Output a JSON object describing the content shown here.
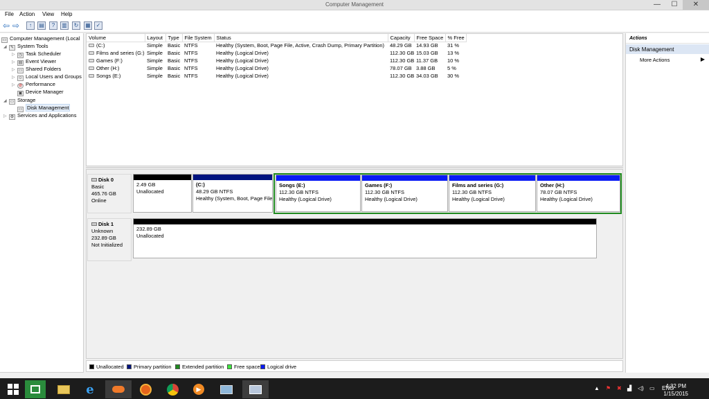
{
  "window": {
    "title": "Computer Management",
    "minimize": "—",
    "maximize": "☐",
    "close": "✕"
  },
  "menu": [
    "File",
    "Action",
    "View",
    "Help"
  ],
  "tree": [
    {
      "label": "Computer Management (Local",
      "indent": 0,
      "exp": ""
    },
    {
      "label": "System Tools",
      "indent": 1,
      "exp": "◢"
    },
    {
      "label": "Task Scheduler",
      "indent": 2,
      "exp": "▷"
    },
    {
      "label": "Event Viewer",
      "indent": 2,
      "exp": "▷"
    },
    {
      "label": "Shared Folders",
      "indent": 2,
      "exp": "▷"
    },
    {
      "label": "Local Users and Groups",
      "indent": 2,
      "exp": "▷"
    },
    {
      "label": "Performance",
      "indent": 2,
      "exp": "▷"
    },
    {
      "label": "Device Manager",
      "indent": 2,
      "exp": ""
    },
    {
      "label": "Storage",
      "indent": 1,
      "exp": "◢"
    },
    {
      "label": "Disk Management",
      "indent": 2,
      "exp": "",
      "selected": true
    },
    {
      "label": "Services and Applications",
      "indent": 1,
      "exp": "▷"
    }
  ],
  "volume_table": {
    "headers": [
      "Volume",
      "Layout",
      "Type",
      "File System",
      "Status",
      "Capacity",
      "Free Space",
      "% Free"
    ],
    "rows": [
      [
        "(C:)",
        "Simple",
        "Basic",
        "NTFS",
        "Healthy (System, Boot, Page File, Active, Crash Dump, Primary Partition)",
        "48.29 GB",
        "14.93 GB",
        "31 %"
      ],
      [
        "Films and series (G:)",
        "Simple",
        "Basic",
        "NTFS",
        "Healthy (Logical Drive)",
        "112.30 GB",
        "15.03 GB",
        "13 %"
      ],
      [
        "Games (F:)",
        "Simple",
        "Basic",
        "NTFS",
        "Healthy (Logical Drive)",
        "112.30 GB",
        "11.37 GB",
        "10 %"
      ],
      [
        "Other (H:)",
        "Simple",
        "Basic",
        "NTFS",
        "Healthy (Logical Drive)",
        "78.07 GB",
        "3.88 GB",
        "5 %"
      ],
      [
        "Songs (E:)",
        "Simple",
        "Basic",
        "NTFS",
        "Healthy (Logical Drive)",
        "112.30 GB",
        "34.03 GB",
        "30 %"
      ]
    ]
  },
  "disks": [
    {
      "name": "Disk 0",
      "kind": "Basic",
      "size": "465.76 GB",
      "state": "Online",
      "partitions": [
        {
          "title": "",
          "size": "2.49 GB",
          "status": "Unallocated",
          "color": "#000000"
        },
        {
          "title": "(C:)",
          "size": "48.29 GB NTFS",
          "status": "Healthy (System, Boot, Page File",
          "color": "#00137f"
        },
        {
          "title": "Songs  (E:)",
          "size": "112.30 GB NTFS",
          "status": "Healthy (Logical Drive)",
          "color": "#0a1cf5"
        },
        {
          "title": "Games  (F:)",
          "size": "112.30 GB NTFS",
          "status": "Healthy (Logical Drive)",
          "color": "#0a1cf5"
        },
        {
          "title": "Films and series  (G:)",
          "size": "112.30 GB NTFS",
          "status": "Healthy (Logical Drive)",
          "color": "#0a1cf5"
        },
        {
          "title": "Other  (H:)",
          "size": "78.07 GB NTFS",
          "status": "Healthy (Logical Drive)",
          "color": "#0a1cf5"
        }
      ]
    },
    {
      "name": "Disk 1",
      "kind": "Unknown",
      "size": "232.89 GB",
      "state": "Not Initialized",
      "partitions": [
        {
          "title": "",
          "size": "232.89 GB",
          "status": "Unallocated",
          "color": "#000000"
        }
      ]
    }
  ],
  "legend": [
    {
      "label": "Unallocated",
      "color": "#000000"
    },
    {
      "label": "Primary partition",
      "color": "#00137f"
    },
    {
      "label": "Extended partition",
      "color": "#1f8a1f"
    },
    {
      "label": "Free space",
      "color": "#3ee63e"
    },
    {
      "label": "Logical drive",
      "color": "#0a1cf5"
    }
  ],
  "actions": {
    "header": "Actions",
    "section": "Disk Management",
    "more": "More Actions"
  },
  "taskbar": {
    "language": "ENG",
    "time": "4:32 PM",
    "date": "1/15/2015"
  },
  "colors": {
    "extended_border": "#1f8a1f",
    "selection": "#dce6f4"
  }
}
